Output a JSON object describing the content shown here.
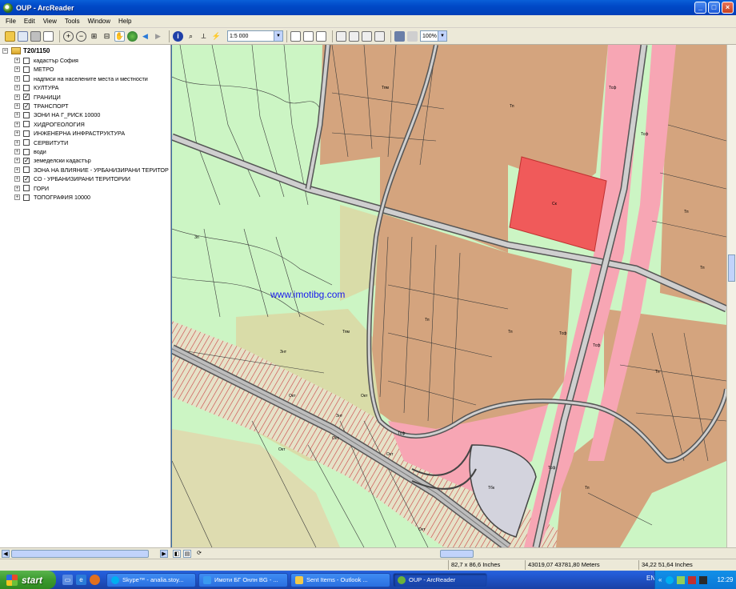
{
  "window": {
    "title": "OUP - ArcReader",
    "buttons": [
      "_",
      "□",
      "×"
    ]
  },
  "menu": [
    "File",
    "Edit",
    "View",
    "Tools",
    "Window",
    "Help"
  ],
  "toolbar": {
    "scale_value": "1:5 000",
    "zoom_value": "100%"
  },
  "toc": {
    "root_label": "T20/1150",
    "layers": [
      {
        "label": "кадастър София",
        "checked": false
      },
      {
        "label": "МЕТРО",
        "checked": false
      },
      {
        "label": "надписи на населените места и местности",
        "checked": false
      },
      {
        "label": "КУЛТУРА",
        "checked": false
      },
      {
        "label": "ГРАНИЦИ",
        "checked": true
      },
      {
        "label": "ТРАНСПОРТ",
        "checked": true
      },
      {
        "label": "ЗОНИ НА Г_РИСК 10000",
        "checked": false
      },
      {
        "label": "ХИДРОГЕОЛОГИЯ",
        "checked": false
      },
      {
        "label": "ИНЖЕНЕРНА ИНФРАСТРУКТУРА",
        "checked": false
      },
      {
        "label": "СЕРВИТУТИ",
        "checked": false
      },
      {
        "label": "води",
        "checked": false
      },
      {
        "label": "земеделски кадастър",
        "checked": true
      },
      {
        "label": "ЗОНА НА ВЛИЯНИЕ - УРБАНИЗИРАНИ ТЕРИТОР",
        "checked": false
      },
      {
        "label": "СО - УРБАНИЗИРАНИ ТЕРИТОРИИ",
        "checked": true
      },
      {
        "label": "ГОРИ",
        "checked": false
      },
      {
        "label": "ТОПОГРАФИЯ 10000",
        "checked": false
      }
    ]
  },
  "map": {
    "watermark": "www.imotibg.com",
    "zone_labels": {
      "tc_upper_left": "Тпм",
      "tc_upper": "Тп",
      "tsf_upper": "Тсф",
      "tsf_right": "Тсф",
      "tc_red": "Ск",
      "tp_right1": "Тп",
      "tp_right2": "Тп",
      "tp_right3": "Тп",
      "tp_mid": "Тп",
      "tpm_mid": "Тпм",
      "tsf_mid": "Тсф",
      "tsf_bottom": "Тсф",
      "tsf_bottom2": "Тсф",
      "tp_bottom": "Тп",
      "tp_bottom2": "Тп",
      "tbk": "Тбк",
      "zp_left": "Зп",
      "znst1": "Знт",
      "znst2": "Знт",
      "okt1": "Окт",
      "okt2": "Окт",
      "okt3": "Окт",
      "okt4": "Окт",
      "okt5": "Окт",
      "okt6": "Окт",
      "tsf_ring": "Тсф"
    }
  },
  "status": {
    "page_size": "82,7 x 86,6 Inches",
    "coords": "43019,07  43781,80 Meters",
    "page_coords": "34,22  51,64 Inches"
  },
  "taskbar": {
    "start": "start",
    "tasks": [
      "Skype™ - analia.stoy...",
      "Имоти БГ Онлн BG - ...",
      "Sent Items - Outlook ...",
      "OUP - ArcReader"
    ],
    "lang": "EN",
    "clock": "12:29"
  },
  "colors": {
    "map_green": "#ccf5c4",
    "map_brown": "#d4a47e",
    "map_pink": "#f7a6b4",
    "map_red": "#f05a5a",
    "map_olive": "#d9dca8",
    "map_grey": "#d3d3dd"
  }
}
